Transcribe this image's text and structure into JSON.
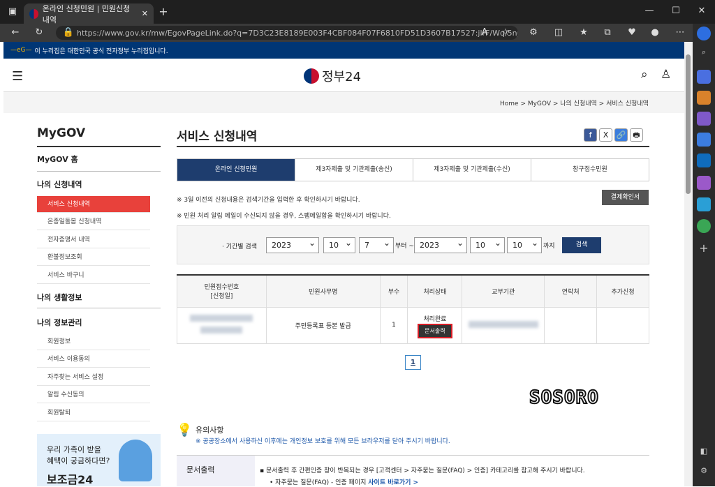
{
  "browser": {
    "tab_title": "온라인 신청민원 | 민원신청 내역",
    "url": "https://www.gov.kr/mw/EgovPageLink.do?q=7D3C23E8189E003F4CBF084F07F6810FD51D3607B17527:jlrF/Wq/5nJdJ...",
    "new_tab": "+",
    "close_tab": "✕"
  },
  "gov_banner": "이 누리집은 대한민국 공식 전자정부 누리집입니다.",
  "logo_text": "정부24",
  "breadcrumb": [
    "Home",
    "MyGOV",
    "나의 신청내역",
    "서비스 신청내역"
  ],
  "left_nav": {
    "title": "MyGOV",
    "home": "MyGOV 홈",
    "section1": "나의 신청내역",
    "items1": [
      "서비스 신청내역",
      "온종일돌봄 신청내역",
      "전자증명서 내역",
      "환불정보조회",
      "서비스 바구니"
    ],
    "section2": "나의 생활정보",
    "section3": "나의 정보관리",
    "items3": [
      "회원정보",
      "서비스 이용동의",
      "자주찾는 서비스 설정",
      "알림 수신동의",
      "회원탈퇴"
    ]
  },
  "banner": {
    "line1": "우리 가족이 받을",
    "line2": "혜택이 궁금하다면?",
    "line3": "보조금24"
  },
  "main": {
    "title": "서비스 신청내역",
    "share": [
      "f",
      "X",
      "🔗",
      "🖶"
    ],
    "tabs": [
      "온라인 신청민원",
      "제3자제출 및 기관제출(송신)",
      "제3자제출 및 기관제출(수신)",
      "창구접수민원"
    ],
    "note1": "※ 3일 이전의 신청내용은 검색기간을 입력한 후 확인하시기 바랍니다.",
    "note2": "※ 민원 처리 알림 메일이 수신되지 않을 경우, 스팸메일함을 확인하시기 바랍니다.",
    "payment_button": "결제확인서"
  },
  "search": {
    "label": "기간별 검색",
    "from": [
      "2023",
      "10",
      "7"
    ],
    "to": [
      "2023",
      "10",
      "10"
    ],
    "mid": "부터 ~",
    "end": "까지",
    "button": "검색"
  },
  "table": {
    "headers": [
      "민원접수번호\n[신청일]",
      "민원사무명",
      "부수",
      "처리상태",
      "교부기관",
      "연락처",
      "추가신청"
    ],
    "row": {
      "name": "주민등록표 등본 발급",
      "count": "1",
      "status": "처리완료",
      "print": "문서출력"
    }
  },
  "pager": "1",
  "watermark": "SOSORO",
  "caution": {
    "title": "유의사항",
    "text": "※ 공공장소에서 사용하신 이후에는 개인정보 보호를 위해 모든 브라우저를 닫아 주시기 바랍니다."
  },
  "doc": {
    "label": "문서출력",
    "text": "문서출력 후 간편인증 창이 반복되는 경우 [고객센터 > 자주묻는 질문(FAQ) > 인증] 카테고리를 참고해 주시기 바랍니다.",
    "sub": "자주묻는 질문(FAQ) - 인증 페이지",
    "link": "사이트 바로가기 >"
  }
}
